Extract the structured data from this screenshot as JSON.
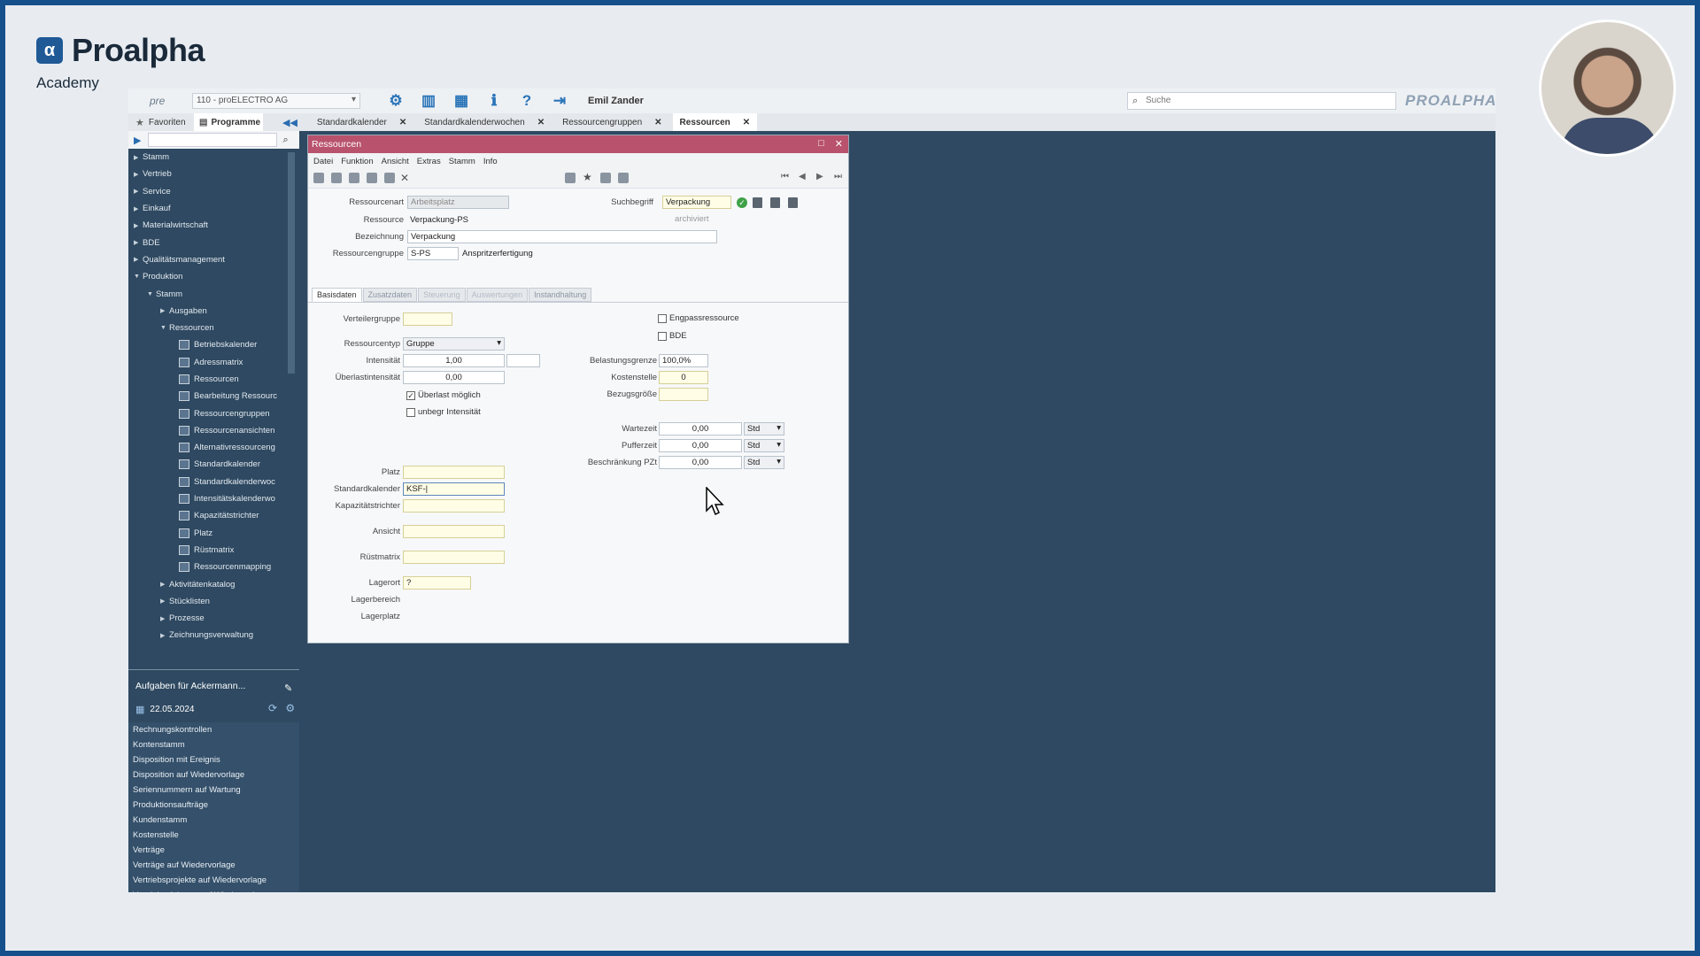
{
  "brand": {
    "name": "Proalpha",
    "subtitle": "Academy",
    "logo_glyph": "α"
  },
  "topbar": {
    "pre_label": "pre",
    "company": "110 - proELECTRO AG",
    "icons": [
      "gear-icon",
      "panel-icon",
      "table-icon",
      "info-icon",
      "help-icon",
      "exit-icon"
    ],
    "user": "Emil Zander",
    "search_placeholder": "Suche",
    "logo_text": "PROALPHA"
  },
  "tabbar": {
    "favorites": "Favoriten",
    "programs": "Programme",
    "tabs": [
      {
        "label": "Standardkalender",
        "active": false
      },
      {
        "label": "Standardkalenderwochen",
        "active": false
      },
      {
        "label": "Ressourcengruppen",
        "active": false
      },
      {
        "label": "Ressourcen",
        "active": true
      }
    ]
  },
  "tree": [
    {
      "label": "Stamm",
      "level": 0,
      "type": "folder"
    },
    {
      "label": "Vertrieb",
      "level": 0,
      "type": "folder"
    },
    {
      "label": "Service",
      "level": 0,
      "type": "folder"
    },
    {
      "label": "Einkauf",
      "level": 0,
      "type": "folder"
    },
    {
      "label": "Materialwirtschaft",
      "level": 0,
      "type": "folder"
    },
    {
      "label": "BDE",
      "level": 0,
      "type": "folder"
    },
    {
      "label": "Qualitätsmanagement",
      "level": 0,
      "type": "folder"
    },
    {
      "label": "Produktion",
      "level": 0,
      "type": "open"
    },
    {
      "label": "Stamm",
      "level": 1,
      "type": "open"
    },
    {
      "label": "Ausgaben",
      "level": 2,
      "type": "folder"
    },
    {
      "label": "Ressourcen",
      "level": 2,
      "type": "open"
    },
    {
      "label": "Betriebskalender",
      "level": 3,
      "type": "page"
    },
    {
      "label": "Adressmatrix",
      "level": 3,
      "type": "page"
    },
    {
      "label": "Ressourcen",
      "level": 3,
      "type": "page"
    },
    {
      "label": "Bearbeitung Ressourc",
      "level": 3,
      "type": "page"
    },
    {
      "label": "Ressourcengruppen",
      "level": 3,
      "type": "page"
    },
    {
      "label": "Ressourcenansichten",
      "level": 3,
      "type": "page"
    },
    {
      "label": "Alternativressourceng",
      "level": 3,
      "type": "page"
    },
    {
      "label": "Standardkalender",
      "level": 3,
      "type": "page"
    },
    {
      "label": "Standardkalenderwoc",
      "level": 3,
      "type": "page"
    },
    {
      "label": "Intensitätskalenderwo",
      "level": 3,
      "type": "page"
    },
    {
      "label": "Kapazitätstrichter",
      "level": 3,
      "type": "page"
    },
    {
      "label": "Platz",
      "level": 3,
      "type": "page"
    },
    {
      "label": "Rüstmatrix",
      "level": 3,
      "type": "page"
    },
    {
      "label": "Ressourcenmapping",
      "level": 3,
      "type": "page"
    },
    {
      "label": "Aktivitätenkatalog",
      "level": 2,
      "type": "folder"
    },
    {
      "label": "Stücklisten",
      "level": 2,
      "type": "folder"
    },
    {
      "label": "Prozesse",
      "level": 2,
      "type": "folder"
    },
    {
      "label": "Zeichnungsverwaltung",
      "level": 2,
      "type": "folder"
    }
  ],
  "tasks": {
    "title": "Aufgaben für Ackermann...",
    "date": "22.05.2024",
    "items": [
      "Rechnungskontrollen",
      "Kontenstamm",
      "Disposition mit Ereignis",
      "Disposition auf Wiedervorlage",
      "Seriennummern auf Wartung",
      "Produktionsaufträge",
      "Kundenstamm",
      "Kostenstelle",
      "Verträge",
      "Verträge auf Wiedervorlage",
      "Vertriebsprojekte auf Wiedervorlage",
      "Vertriebsaktionen auf Wiedervorlage"
    ]
  },
  "dialog": {
    "title": "Ressourcen",
    "menu": [
      "Datei",
      "Funktion",
      "Ansicht",
      "Extras",
      "Stamm",
      "Info"
    ],
    "header": {
      "ressourcenart_label": "Ressourcenart",
      "ressourcenart_value": "Arbeitsplatz",
      "ressource_label": "Ressource",
      "ressource_value": "Verpackung-PS",
      "bezeichnung_label": "Bezeichnung",
      "bezeichnung_value": "Verpackung",
      "gruppe_label": "Ressourcengruppe",
      "gruppe_value": "S-PS",
      "gruppe_desc": "Anspritzerfertigung",
      "suchbegriff_label": "Suchbegriff",
      "suchbegriff_value": "Verpackung",
      "archiviert": "archiviert"
    },
    "tabs": [
      {
        "label": "Basisdaten",
        "state": "active"
      },
      {
        "label": "Zusatzdaten",
        "state": "normal"
      },
      {
        "label": "Steuerung",
        "state": "dim"
      },
      {
        "label": "Auswertungen",
        "state": "dim"
      },
      {
        "label": "Instandhaltung",
        "state": "normal"
      }
    ],
    "basis": {
      "verteilergruppe_label": "Verteilergruppe",
      "verteilergruppe_value": "",
      "typ_label": "Ressourcentyp",
      "typ_value": "Gruppe",
      "intensitaet_label": "Intensität",
      "intensitaet_value": "1,00",
      "ueberlast_int_label": "Überlastintensität",
      "ueberlast_int_value": "0,00",
      "ueberlast_moeglich_label": "Überlast möglich",
      "ueberlast_moeglich_checked": true,
      "unbegr_label": "unbegr Intensität",
      "unbegr_checked": false,
      "engpass_label": "Engpassressource",
      "engpass_checked": false,
      "bde_label": "BDE",
      "bde_checked": false,
      "belastung_label": "Belastungsgrenze",
      "belastung_value": "100,0%",
      "kostenstelle_label": "Kostenstelle",
      "kostenstelle_value": "0",
      "bezugsgroesse_label": "Bezugsgröße",
      "bezugsgroesse_value": "",
      "wartezeit_label": "Wartezeit",
      "wartezeit_value": "0,00",
      "wartezeit_unit": "Std",
      "pufferzeit_label": "Pufferzeit",
      "pufferzeit_value": "0,00",
      "pufferzeit_unit": "Std",
      "beschraenkung_label": "Beschränkung PZt",
      "beschraenkung_value": "0,00",
      "beschraenkung_unit": "Std",
      "platz_label": "Platz",
      "platz_value": "",
      "standardkalender_label": "Standardkalender",
      "standardkalender_value": "KSF-|",
      "kapazitaet_label": "Kapazitätstrichter",
      "kapazitaet_value": "",
      "ansicht_label": "Ansicht",
      "ansicht_value": "",
      "ruestmatrix_label": "Rüstmatrix",
      "ruestmatrix_value": "",
      "lagerort_label": "Lagerort",
      "lagerort_value": "?",
      "lagerbereich_label": "Lagerbereich",
      "lagerplatz_label": "Lagerplatz"
    }
  }
}
